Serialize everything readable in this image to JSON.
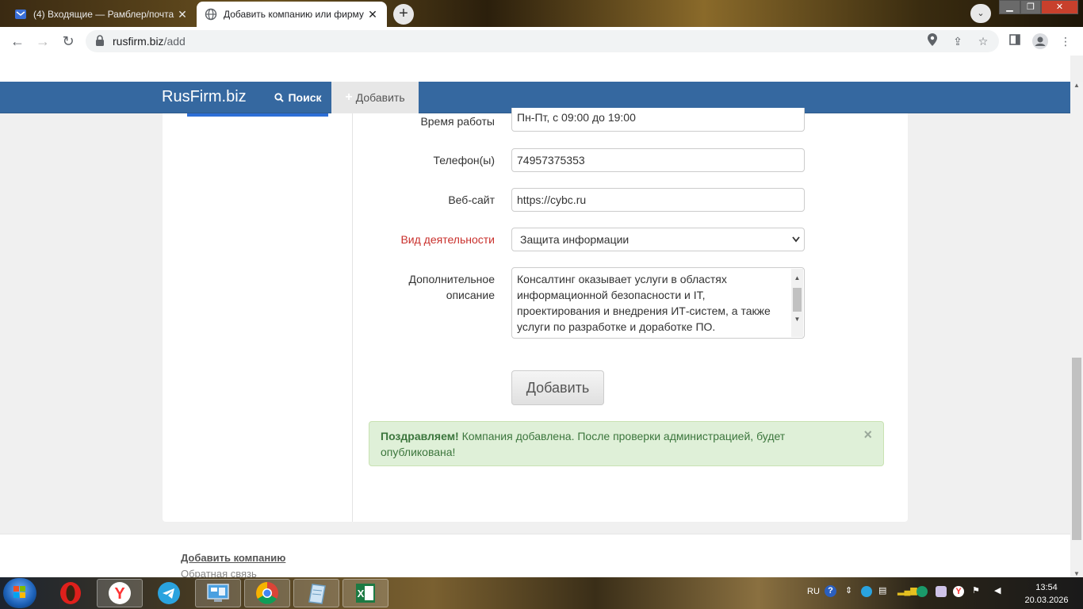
{
  "browser": {
    "tabs": [
      {
        "title": "(4) Входящие — Рамблер/почта",
        "active": false,
        "favicon": "mail-icon"
      },
      {
        "title": "Добавить компанию или фирму",
        "active": true,
        "favicon": "globe-icon"
      }
    ],
    "url_host": "rusfirm.biz",
    "url_path": "/add"
  },
  "site": {
    "brand": "RusFirm.biz",
    "nav_search": "Поиск",
    "nav_add": "Добавить"
  },
  "form": {
    "hours_label": "Время работы",
    "hours_value": "Пн-Пт, с 09:00 до 19:00",
    "phone_label": "Телефон(ы)",
    "phone_value": "74957375353",
    "website_label": "Веб-сайт",
    "website_value": "https://cybc.ru",
    "activity_label": "Вид деятельности",
    "activity_value": "Защита информации",
    "desc_label_1": "Дополнительное",
    "desc_label_2": "описание",
    "desc_lines": [
      "Консалтинг оказывает услуги в областях",
      "информационной безопасности и IT,",
      "проектирования и внедрения ИТ-систем, а также",
      "услуги по разработке и доработке ПО."
    ],
    "submit_label": "Добавить"
  },
  "alert": {
    "strong": "Поздравляем!",
    "text": " Компания добавлена. После проверки администрацией, будет опубликована!",
    "close": "×"
  },
  "footer": {
    "link_add": "Добавить компанию",
    "link_feedback": "Обратная связь"
  },
  "taskbar": {
    "lang": "RU",
    "time": "13:54",
    "date": "20.03.2026"
  },
  "colors": {
    "navbar": "#3568a0",
    "alert_bg": "#dff0d8",
    "alert_text": "#3c763d",
    "required_label": "#c9302c"
  }
}
